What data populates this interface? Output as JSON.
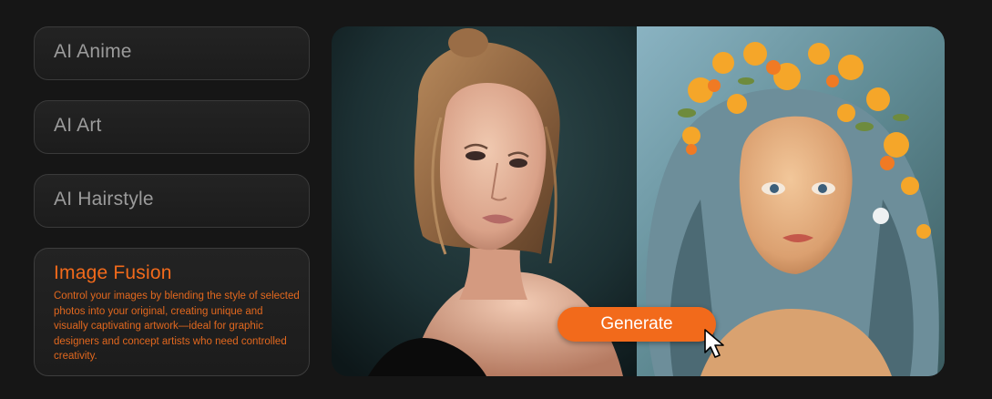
{
  "features": {
    "anime": {
      "label": "AI Anime"
    },
    "art": {
      "label": "AI Art"
    },
    "hairstyle": {
      "label": "AI Hairstyle"
    },
    "fusion": {
      "label": "Image Fusion",
      "description": "Control your images by blending the style of selected photos into your original, creating unique and visually captivating artwork—ideal for graphic designers and concept artists who need controlled creativity."
    }
  },
  "preview": {
    "generate_label": "Generate"
  },
  "colors": {
    "accent": "#f26a1b",
    "background": "#161616",
    "inactive_text": "#9b9b9b"
  },
  "icons": {
    "cursor": "arrow-cursor-icon"
  }
}
